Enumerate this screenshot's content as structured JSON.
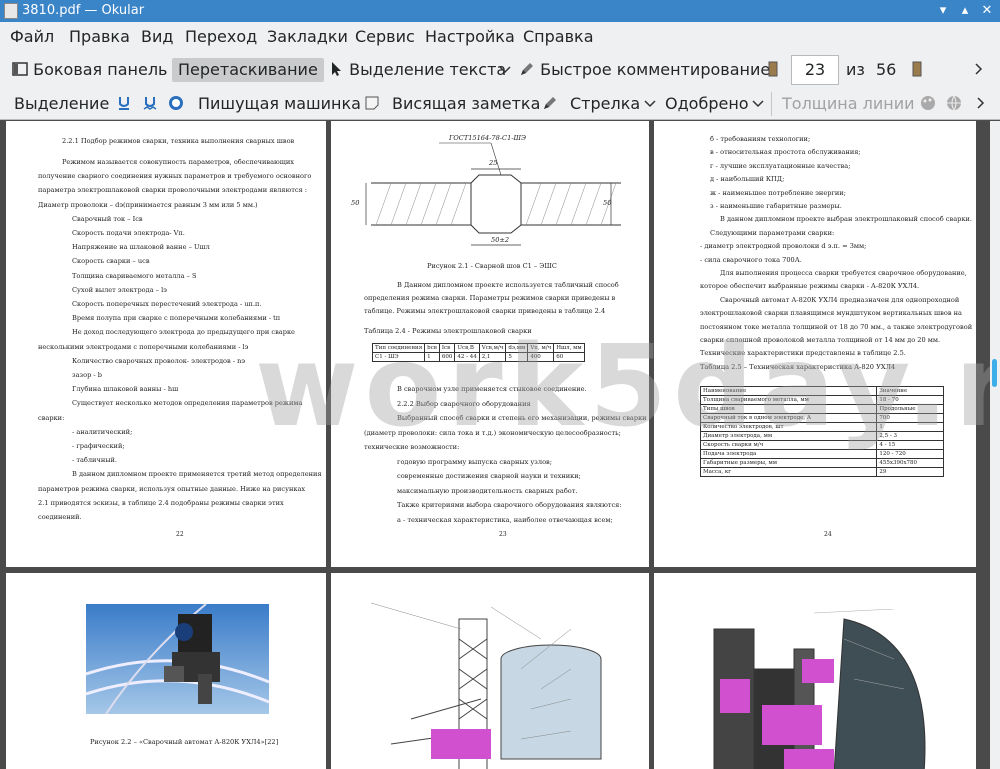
{
  "window": {
    "title": "3810.pdf  — Okular"
  },
  "menu": [
    "Файл",
    "Правка",
    "Вид",
    "Переход",
    "Закладки",
    "Сервис",
    "Настройка",
    "Справка"
  ],
  "toolbar1": {
    "sidebar": "Боковая панель",
    "drag": "Перетаскивание",
    "text_select": "Выделение текста",
    "quick_annot": "Быстрое комментирование",
    "page_current": "23",
    "page_of": "из",
    "page_total": "56"
  },
  "toolbar2": {
    "selection": "Выделение",
    "typewriter": "Пишущая машинка",
    "note": "Висящая заметка",
    "arrow": "Стрелка",
    "stamp": "Одобрено",
    "line_width": "Толщина линии"
  },
  "watermark": "work5day.ru",
  "page22": {
    "heading": "2.2.1 Подбор режимов сварки, техника выполнения сварных швов",
    "lines": [
      "Режимом называется совокупность параметров, обеспечивающих",
      "получение сварного соединения нужных параметров и требуемого основного",
      "параметра электрошлаковой сварки проволочными электродами являются :",
      "Диаметр проволоки – dэ(принимается равным 3 мм или 5 мм.)",
      "Сварочный ток – Iсв",
      "Скорость подачи электрода- Vп.",
      "Напряжение на шлаковой ванне – Uшл",
      "Скорость сварки – uсв",
      "Толщина свариваемого металла – S",
      "Сухой вылет электрода – lэ",
      "Скорость поперечных перестечений электрода - uп.п.",
      "Время полупа при сварке с поперечными колебаниями - tп",
      "Не доход последующего электрода до предыдущего при сварке",
      "несколькими электродами с поперечными колебаниями - lэ",
      "Количество сварочных проволок- электродов - nэ",
      "зазор - b",
      "Глубина шлаковой ванны - hш",
      "Существует несколько методов определения параметров режима",
      "сварки:",
      "- аналитический;",
      "- графический;",
      "- табличный.",
      "В данном дипломном проекте применяется третий метод определения",
      "параметров режима сварки, используя опытные данные. Ниже на рисунках",
      "2.1 приводятся эскизы, в таблице 2.4 подобраны режимы сварки этих",
      "соединений."
    ],
    "num": "22"
  },
  "page23": {
    "drawing_label": "ГОСТ15164-78-С1-ШЭ",
    "dim_top": "25",
    "dim_bottom": "50±2",
    "dim_left": "50",
    "dim_right": "50",
    "caption": "Рисунок 2.1 - Сварной шов С1 – ЭШС",
    "lines_a": [
      "В Данном дипломном проекте используется табличный способ",
      "определения режима сварки. Параметры режимов сварки приведены в",
      "таблице. Режимы электрошлаковой сварки приведены в таблице 2.4"
    ],
    "table_title": "Таблица 2.4 - Режимы электрошлаковой сварки",
    "table": [
      [
        "Тип соединения",
        "bсв",
        "Iсв",
        "Uсв,В",
        "Vсв,м/ч",
        "dэ,мм",
        "Vп, м/ч",
        "Hшл, мм"
      ],
      [
        "С1 - ШЭ",
        "1",
        "600",
        "42 - 44",
        "2,1",
        "5",
        "400",
        "60"
      ]
    ],
    "lines_b": [
      "В сварочном узле применяется стыковое соединение.",
      "2.2.2 Выбор сварочного оборудования",
      "Выбранный способ сварки и степень его механизации, режимы сварки",
      "(диаметр проволоки: сила тока и т.д.) экономическую целесообразность;",
      "технические возможности:",
      "годовую программу выпуска сварных узлов;",
      "современные достижения сварной науки и техники;",
      "максимальную производительность сварных работ.",
      "Также критериями выбора сварочного оборудования являются:",
      "а - техническая характеристика, наиболее отвечающая всем;"
    ],
    "num": "23"
  },
  "page24": {
    "lines_a": [
      "б - требованиям технологии;",
      "в - относительная простота обслуживания;",
      "г - лучшие эксплуатационные качества;",
      "д - наибольший КПД;",
      "ж - наименьшее потребление энергии;",
      "з - наименьшие габаритные размеры.",
      "В данном дипломном проекте выбран электрошлаковый способ сварки.",
      "Следующими параметрами сварки:",
      "- диаметр электродной проволоки d э.п. = 3мм;",
      "- сила сварочного тока 700А.",
      "Для выполнения процесса сварки требуется сварочное оборудование,",
      "которое обеспечит выбранные режимы сварки - А-820К УХЛ4.",
      "Сварочный автомат А-820К УХЛ4 предназначен для однопроходной",
      "электрошлаковой сварки плавящимся мундштуком вертикальных швов на",
      "постоянном токе металла толщиной от 18 до 70 мм., а также электродуговой",
      "сварки сплошной проволокой металла толщиной от 14 мм до 20 мм.",
      "Технические характеристики представлены в таблице 2.5.",
      "Таблица 2.5 – Техническая характеристика А-820 УХЛ4"
    ],
    "table": [
      [
        "Наименование",
        "Значение"
      ],
      [
        "Толщина свариваемого металла, мм",
        "18 - 70"
      ],
      [
        "Типы швов",
        "Продольные"
      ],
      [
        "Сварочный ток в одном электроде, А",
        "700"
      ],
      [
        "Количество электродов, шт",
        "1"
      ],
      [
        "Диаметр электрода, мм",
        "2,5 - 3"
      ],
      [
        "Скорость сварки м/ч",
        "4 - 15"
      ],
      [
        "Подача электрода",
        "120 - 720"
      ],
      [
        "Габаритные размеры, мм",
        "455х390х780"
      ],
      [
        "Масса, кг",
        "29"
      ]
    ],
    "num": "24"
  },
  "page25": {
    "caption": "Рисунок 2.2 – «Сварочный автомат А-820К УХЛ4»[22]"
  },
  "colors": {
    "titlebar": "#3a84c8",
    "accent": "#3daee9",
    "magenta": "#d050d0"
  }
}
